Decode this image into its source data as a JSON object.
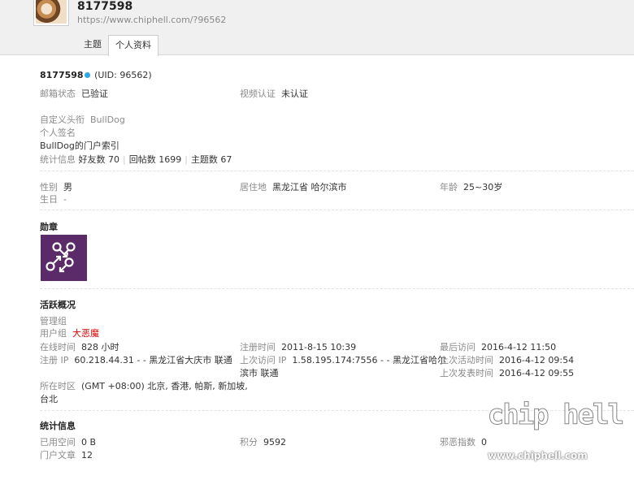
{
  "header": {
    "username": "8177598",
    "url": "https://www.chiphell.com/?96562",
    "tabs": [
      {
        "label": "主题",
        "active": false
      },
      {
        "label": "个人资料",
        "active": true
      }
    ]
  },
  "profile": {
    "name": "8177598",
    "uid": "(UID: 96562)",
    "email_label": "邮箱状态",
    "email_value": "已验证",
    "video_label": "视频认证",
    "video_value": "未认证",
    "custom_title_label": "自定义头衔",
    "custom_title_value": "BullDog",
    "signature_label": "个人签名",
    "portal_link": "BullDog的门户索引",
    "stats_label": "统计信息",
    "friends": "好友数 70",
    "replies": "回帖数 1699",
    "threads": "主题数 67"
  },
  "personal": {
    "gender_label": "性别",
    "gender_value": "男",
    "birthday_label": "生日",
    "birthday_value": "-",
    "residence_label": "居住地",
    "residence_value": "黑龙江省 哈尔滨市",
    "age_label": "年龄",
    "age_value": "25~30岁"
  },
  "medals": {
    "title": "勋章",
    "icon": "arrows-circles-medal-icon"
  },
  "activity": {
    "title": "活跃概况",
    "admin_group_label": "管理组",
    "user_group_label": "用户组",
    "user_group_value": "大恶魔",
    "online_label": "在线时间",
    "online_value": "828 小时",
    "reg_time_label": "注册时间",
    "reg_time_value": "2011-8-15 10:39",
    "last_visit_label": "最后访问",
    "last_visit_value": "2016-4-12 11:50",
    "reg_ip_label": "注册 IP",
    "reg_ip_value": "60.218.44.31 - - 黑龙江省大庆市 联通",
    "last_ip_label": "上次访问 IP",
    "last_ip_value": "1.58.195.174:7556 - - 黑龙江省哈尔",
    "last_ip_value_2": "滨市 联通",
    "last_active_label": "上次活动时间",
    "last_active_value": "2016-4-12 09:54",
    "last_post_label": "上次发表时间",
    "last_post_value": "2016-4-12 09:55",
    "timezone_label": "所在时区",
    "timezone_value": "(GMT +08:00) 北京, 香港, 帕斯, 新加坡,",
    "timezone_value_2": "台北"
  },
  "stats": {
    "title": "统计信息",
    "space_label": "已用空间",
    "space_value": "0 B",
    "points_label": "积分",
    "points_value": "9592",
    "evil_label": "邪恶指数",
    "evil_value": "0",
    "articles_label": "门户文章",
    "articles_value": "12"
  },
  "watermark": {
    "big": "chip hell",
    "small": "www.chiphell.com"
  }
}
